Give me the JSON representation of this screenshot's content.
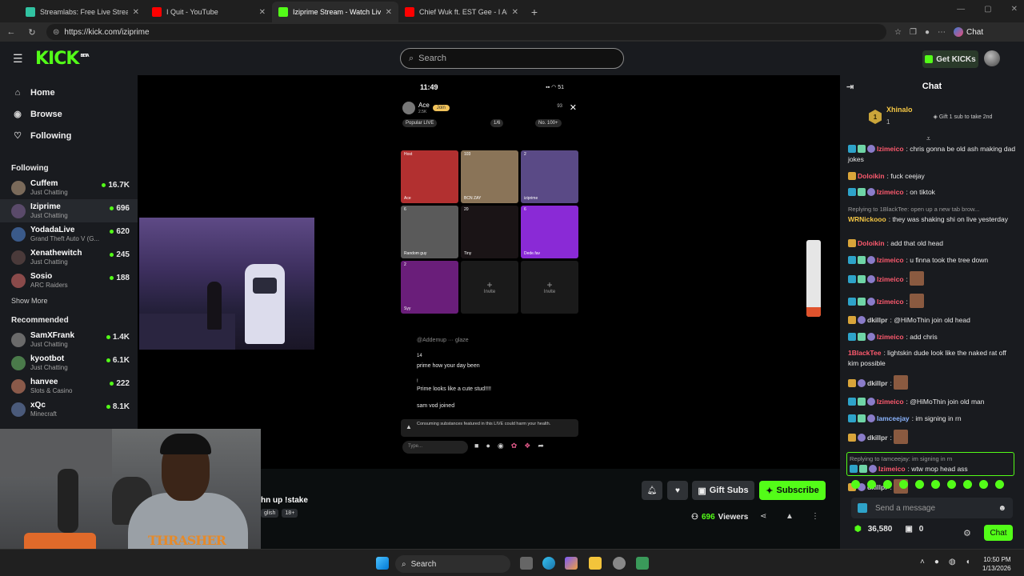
{
  "browser": {
    "tabs": [
      {
        "title": "Streamlabs: Free Live Streaming &",
        "color": "#31c3a2"
      },
      {
        "title": "I Quit - YouTube",
        "color": "#ff0000"
      },
      {
        "title": "Iziprime Stream - Watch Live",
        "color": "#53fc18"
      },
      {
        "title": "Chief Wuk ft. EST Gee - I Ain't Lyin",
        "color": "#ff0000"
      }
    ],
    "url": "https://kick.com/iziprime",
    "copilot_label": "Chat"
  },
  "header": {
    "logo": "KICK",
    "logo_sup": "BETA",
    "search_placeholder": "Search",
    "get_kicks": "Get KICKs"
  },
  "sidebar": {
    "nav": [
      {
        "label": "Home",
        "icon": "⌂"
      },
      {
        "label": "Browse",
        "icon": "◉"
      },
      {
        "label": "Following",
        "icon": "♡"
      }
    ],
    "following_title": "Following",
    "following": [
      {
        "name": "Cuffem",
        "category": "Just Chatting",
        "viewers": "16.7K",
        "color": "#7a6a5a"
      },
      {
        "name": "Iziprime",
        "category": "Just Chatting",
        "viewers": "696",
        "color": "#5a4a6a"
      },
      {
        "name": "YodadaLive",
        "category": "Grand Theft Auto V (G...",
        "viewers": "620",
        "color": "#3a5a8a"
      },
      {
        "name": "Xenathewitch",
        "category": "Just Chatting",
        "viewers": "245",
        "color": "#4a3a3a"
      },
      {
        "name": "Sosio",
        "category": "ARC Raiders",
        "viewers": "188",
        "color": "#8a4a4a"
      }
    ],
    "show_more": "Show More",
    "recommended_title": "Recommended",
    "recommended": [
      {
        "name": "SamXFrank",
        "category": "Just Chatting",
        "viewers": "1.4K",
        "color": "#6a6a6a"
      },
      {
        "name": "kyootbot",
        "category": "Just Chatting",
        "viewers": "6.1K",
        "color": "#4a7a4a"
      },
      {
        "name": "hanvee",
        "category": "Slots & Casino",
        "viewers": "222",
        "color": "#8a5a4a"
      },
      {
        "name": "xQc",
        "category": "Minecraft",
        "viewers": "8.1K",
        "color": "#4a5a7a"
      }
    ]
  },
  "phone": {
    "time": "11:49",
    "battery": "51",
    "host_name": "Ace",
    "host_sub": "2.5K",
    "follow": "Join",
    "viewer_count": "93",
    "tags": [
      "Popular LIVE",
      "1/6",
      "No. 100+"
    ],
    "cells": [
      {
        "label": "Ace",
        "count": "Host",
        "bg": "#b23030"
      },
      {
        "label": "BCN ZAY",
        "count": "103",
        "bg": "#8a7458"
      },
      {
        "label": "iziprime",
        "count": "2",
        "bg": "#5a4a86"
      },
      {
        "label": "Random guy",
        "count": "6",
        "bg": "#5a5a5a"
      },
      {
        "label": "Tiny",
        "count": "20",
        "bg": "#1a1416"
      },
      {
        "label": "Dede.fav",
        "count": "6",
        "bg": "#8a2ad6"
      },
      {
        "label": "Syy",
        "count": "2",
        "bg": "#6a1e7a"
      }
    ],
    "invite": "Invite",
    "messages": [
      {
        "text": "@Addemup ··· glaze",
        "dim": true
      },
      {
        "text": "14",
        "dim": false
      },
      {
        "text": "prime how your day been",
        "dim": false
      },
      {
        "text": "!",
        "dim": false
      },
      {
        "text": "Prime looks like a cute stud!!!!",
        "dim": false
      },
      {
        "text": "sam vod joined",
        "dim": false
      }
    ],
    "warning": "Consuming substances featured in this LIVE could harm your health.",
    "type_placeholder": "Type..."
  },
  "stream": {
    "title_partial": "hn up !stake",
    "badges": [
      "glish",
      "18+"
    ],
    "gift_subs": "Gift Subs",
    "subscribe": "Subscribe",
    "viewers": "696",
    "viewers_label": "Viewers"
  },
  "chat": {
    "title": "Chat",
    "pinned_rank": "1",
    "pinned_user": "Xhinalo",
    "pinned_count": "1",
    "pinned_text": "Gift 1 sub to take 2nd",
    "messages": [
      {
        "user": "Izimeico",
        "color": "#ff5a6e",
        "badges": [
          "v",
          "s",
          "c"
        ],
        "text": "chris gonna be old ash making dad jokes"
      },
      {
        "user": "Doloikin",
        "color": "#ff5a6e",
        "badges": [
          "g"
        ],
        "text": "fuck ceejay"
      },
      {
        "user": "Izimeico",
        "color": "#ff5a6e",
        "badges": [
          "v",
          "s",
          "c"
        ],
        "text": "on tiktok"
      },
      {
        "reply": "Replying to 1BlackTee: open up a new tab brow...",
        "user": "WRNickooo",
        "color": "#f6c845",
        "badges": [],
        "text": "they was shaking shi on live yesterday"
      },
      {
        "user": "Doloikin",
        "color": "#ff5a6e",
        "badges": [
          "g"
        ],
        "text": "add that old head"
      },
      {
        "user": "Izimeico",
        "color": "#ff5a6e",
        "badges": [
          "v",
          "s",
          "c"
        ],
        "text": "u finna took the tree down"
      },
      {
        "user": "Izimeico",
        "color": "#ff5a6e",
        "badges": [
          "v",
          "s",
          "c"
        ],
        "text": "",
        "emote": true
      },
      {
        "user": "Izimeico",
        "color": "#ff5a6e",
        "badges": [
          "v",
          "s",
          "c"
        ],
        "text": "",
        "emote": true
      },
      {
        "user": "dkillpr",
        "color": "#cfcfcf",
        "badges": [
          "g",
          "c"
        ],
        "text": "@HiMoThin join old head"
      },
      {
        "user": "Izimeico",
        "color": "#ff5a6e",
        "badges": [
          "v",
          "s",
          "c"
        ],
        "text": "add chris"
      },
      {
        "user": "1BlackTee",
        "color": "#ff5a6e",
        "badges": [],
        "text": "lightskin dude look like the naked rat off kim possible"
      },
      {
        "user": "dkillpr",
        "color": "#cfcfcf",
        "badges": [
          "g",
          "c"
        ],
        "text": "",
        "emote": true
      },
      {
        "user": "Izimeico",
        "color": "#ff5a6e",
        "badges": [
          "v",
          "s",
          "c"
        ],
        "text": "@HiMoThin join old man"
      },
      {
        "user": "Iamceejay",
        "color": "#8ab4ff",
        "badges": [
          "v",
          "s",
          "c"
        ],
        "text": "im signing in rn"
      },
      {
        "user": "dkillpr",
        "color": "#cfcfcf",
        "badges": [
          "g",
          "c"
        ],
        "text": "",
        "emote": true
      },
      {
        "reply": "Replying to Iamceejay: im signing in rn",
        "user": "Izimeico",
        "color": "#ff5a6e",
        "badges": [
          "v",
          "s",
          "c"
        ],
        "text": "wtw mop head ass",
        "highlight": true
      },
      {
        "user": "dkillpr",
        "color": "#cfcfcf",
        "badges": [
          "g",
          "c"
        ],
        "text": "",
        "emote": true
      }
    ],
    "input_placeholder": "Send a message",
    "points": "36,580",
    "gift_count": "0",
    "send": "Chat"
  },
  "taskbar": {
    "search": "Search",
    "time": "10:50 PM",
    "date": "1/13/2026"
  }
}
